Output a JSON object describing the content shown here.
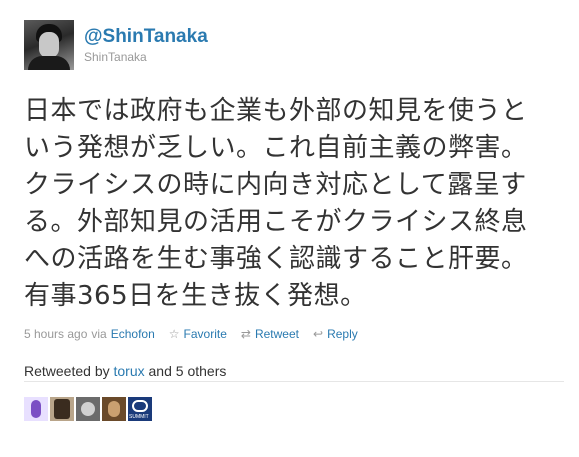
{
  "tweet": {
    "screen_name": "@ShinTanaka",
    "full_name": "ShinTanaka",
    "text": "日本では政府も企業も外部の知見を使うという発想が乏しい。これ自前主義の弊害。クライシスの時に内向き対応として露呈する。外部知見の活用こそがクライシス終息への活路を生む事強く認識すること肝要。有事365日を生き抜く発想。",
    "timestamp": "5 hours ago",
    "via_label": "via",
    "via_app": "Echofon",
    "actions": {
      "favorite": "Favorite",
      "retweet": "Retweet",
      "reply": "Reply"
    }
  },
  "icons": {
    "favorite": "☆",
    "retweet": "⇄",
    "reply": "↩"
  },
  "retweets": {
    "prefix": "Retweeted by",
    "user": "torux",
    "suffix": "and 5 others"
  },
  "retweeter_avatars": [
    {
      "name": "retweeter-avatar-1"
    },
    {
      "name": "retweeter-avatar-2"
    },
    {
      "name": "retweeter-avatar-3"
    },
    {
      "name": "retweeter-avatar-4"
    },
    {
      "name": "retweeter-avatar-5",
      "label": "SUMMIT"
    }
  ]
}
